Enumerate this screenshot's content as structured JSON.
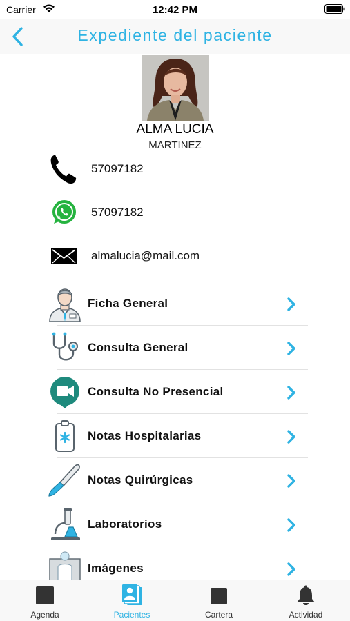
{
  "status_bar": {
    "carrier": "Carrier",
    "time": "12:42 PM"
  },
  "nav": {
    "title": "Expediente del paciente",
    "back_icon": "chevron-left-icon"
  },
  "patient": {
    "name": "ALMA LUCIA",
    "surname": "MARTINEZ"
  },
  "contacts": [
    {
      "icon": "phone-icon",
      "value": "57097182"
    },
    {
      "icon": "whatsapp-icon",
      "value": "57097182"
    },
    {
      "icon": "mail-icon",
      "value": "almalucia@mail.com"
    }
  ],
  "menu": [
    {
      "icon": "doctor-icon",
      "label": "Ficha General"
    },
    {
      "icon": "stethoscope-icon",
      "label": "Consulta General"
    },
    {
      "icon": "video-call-icon",
      "label": "Consulta No Presencial"
    },
    {
      "icon": "clipboard-icon",
      "label": "Notas Hospitalarias"
    },
    {
      "icon": "scalpel-icon",
      "label": "Notas Quirúrgicas"
    },
    {
      "icon": "microscope-icon",
      "label": "Laboratorios"
    },
    {
      "icon": "xray-icon",
      "label": "Imágenes"
    }
  ],
  "tabs": [
    {
      "icon": "agenda-icon",
      "label": "Agenda",
      "active": false
    },
    {
      "icon": "patients-icon",
      "label": "Pacientes",
      "active": true
    },
    {
      "icon": "wallet-icon",
      "label": "Cartera",
      "active": false
    },
    {
      "icon": "bell-icon",
      "label": "Actividad",
      "active": false
    }
  ],
  "colors": {
    "accent": "#2fb3e3",
    "whatsapp": "#25b33f",
    "divider": "#e2e2e2"
  }
}
